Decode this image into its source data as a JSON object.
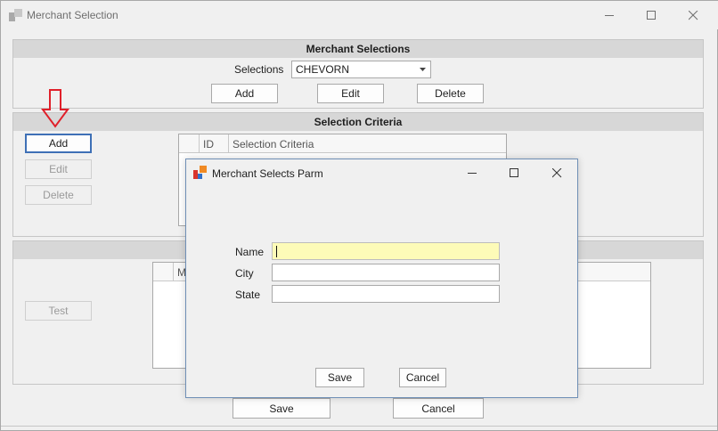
{
  "window": {
    "title": "Merchant Selection",
    "controls": [
      "minimize",
      "maximize",
      "close"
    ]
  },
  "merchant_selections": {
    "header": "Merchant Selections",
    "selections_label": "Selections",
    "selections_value": "CHEVORN",
    "add_label": "Add",
    "edit_label": "Edit",
    "delete_label": "Delete"
  },
  "selection_criteria": {
    "header": "Selection Criteria",
    "add_label": "Add",
    "edit_label": "Edit",
    "delete_label": "Delete",
    "columns": [
      "ID",
      "Selection Criteria"
    ]
  },
  "test_panel": {
    "test_label": "Test",
    "column_partial": "Me"
  },
  "footer": {
    "save_label": "Save",
    "cancel_label": "Cancel"
  },
  "annotation": {
    "arrow_color": "#e0202a",
    "points_to": "selection_criteria.add"
  },
  "dialog": {
    "title": "Merchant Selects Parm",
    "fields": [
      {
        "label": "Name",
        "value": ""
      },
      {
        "label": "City",
        "value": ""
      },
      {
        "label": "State",
        "value": ""
      }
    ],
    "save_label": "Save",
    "cancel_label": "Cancel"
  }
}
